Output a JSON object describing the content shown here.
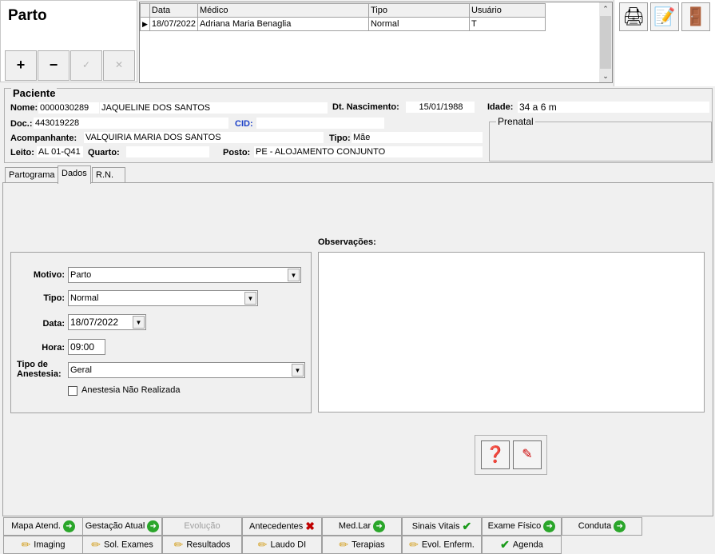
{
  "title": "Parto",
  "toolbar": {
    "add": "+",
    "remove": "−",
    "edit": "✓",
    "cancel": "✕"
  },
  "grid": {
    "headers": [
      "Data",
      "Médico",
      "Tipo",
      "Usuário"
    ],
    "rows": [
      [
        "18/07/2022",
        "Adriana Maria Benaglia",
        "Normal",
        "T"
      ]
    ]
  },
  "paciente": {
    "legend": "Paciente",
    "nome_label": "Nome:",
    "nome_id": "0000030289",
    "nome": "JAQUELINE DOS SANTOS",
    "nasc_label": "Dt. Nascimento:",
    "nasc": "15/01/1988",
    "idade_label": "Idade:",
    "idade": "34 a 6 m",
    "doc_label": "Doc.:",
    "doc": "443019228",
    "cid_label": "CID:",
    "cid": "",
    "acomp_label": "Acompanhante:",
    "acomp": "VALQUIRIA MARIA DOS SANTOS",
    "tipo_label": "Tipo:",
    "tipo": "Mãe",
    "leito_label": "Leito:",
    "leito": "AL 01-Q41",
    "quarto_label": "Quarto:",
    "quarto": "",
    "posto_label": "Posto:",
    "posto": "PE - ALOJAMENTO CONJUNTO",
    "prenatal": "Prenatal"
  },
  "tabs": [
    "Partograma",
    "Dados",
    "R.N."
  ],
  "form": {
    "motivo_label": "Motivo:",
    "motivo": "Parto",
    "tipo_label": "Tipo:",
    "tipo": "Normal",
    "data_label": "Data:",
    "data": "18/07/2022",
    "hora_label": "Hora:",
    "hora": "09:00",
    "anest_label1": "Tipo de",
    "anest_label2": "Anestesia:",
    "anest": "Geral",
    "nao_realizada": "Anestesia Não Realizada",
    "obs_label": "Observações:"
  },
  "nav_row1": [
    "Mapa Atend.",
    "Gestação Atual",
    "Evolução",
    "Antecedentes",
    "Med.Lar",
    "Sinais Vitais",
    "Exame Físico",
    "Conduta"
  ],
  "nav_row2": [
    "Imaging",
    "Sol. Exames",
    "Resultados",
    "Laudo DI",
    "Terapias",
    "Evol. Enferm.",
    "Agenda"
  ]
}
